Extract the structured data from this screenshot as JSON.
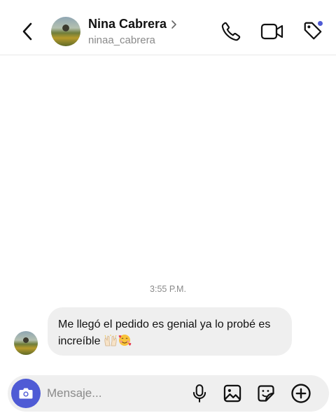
{
  "header": {
    "contact_name": "Nina Cabrera",
    "username": "ninaa_cabrera",
    "name_chevron_icon": "chevron-right-icon",
    "back_icon": "chevron-left-icon",
    "call_icon": "phone-icon",
    "video_icon": "video-camera-icon",
    "tag_icon": "tag-icon",
    "notification_dot_color": "#4f5bd5"
  },
  "conversation": {
    "timestamp": "3:55 P.M.",
    "messages": [
      {
        "sender": "Nina Cabrera",
        "text": "Me llegó el pedido es genial ya lo probé es increíble",
        "emojis": [
          "raising-hands-emoji",
          "smiling-face-with-hearts-emoji"
        ]
      }
    ]
  },
  "composer": {
    "placeholder": "Mensaje...",
    "camera_icon": "camera-icon",
    "mic_icon": "microphone-icon",
    "gallery_icon": "image-icon",
    "sticker_icon": "sticker-icon",
    "plus_icon": "plus-circle-icon",
    "accent_color": "#4f5bd5"
  }
}
